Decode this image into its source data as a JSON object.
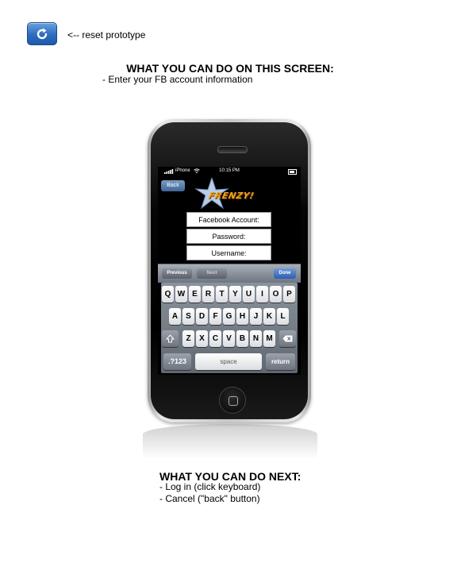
{
  "reset": {
    "icon": "refresh-icon",
    "label": "<-- reset prototype"
  },
  "screen_section": {
    "heading": "WHAT YOU CAN DO ON THIS SCREEN:",
    "items": [
      "- Enter your FB account information"
    ]
  },
  "phone": {
    "status_bar": {
      "carrier": "iPhone",
      "time": "10:15 PM",
      "signal_icon": "signal-bars-icon",
      "wifi_icon": "wifi-icon",
      "battery_icon": "battery-icon"
    },
    "back_label": "Back",
    "logo_text": "FRENZY!",
    "fields": [
      "Facebook Account:",
      "Password:",
      "Username:"
    ],
    "accessory": {
      "previous": "Previous",
      "next": "Next",
      "done": "Done"
    },
    "keyboard": {
      "row1": [
        "Q",
        "W",
        "E",
        "R",
        "T",
        "Y",
        "U",
        "I",
        "O",
        "P"
      ],
      "row2": [
        "A",
        "S",
        "D",
        "F",
        "G",
        "H",
        "J",
        "K",
        "L"
      ],
      "row3": [
        "Z",
        "X",
        "C",
        "V",
        "B",
        "N",
        "M"
      ],
      "numbers": ".?123",
      "space": "space",
      "return": "return"
    }
  },
  "next_section": {
    "heading": "WHAT YOU CAN DO NEXT:",
    "items": [
      "- Log in (click keyboard)",
      "- Cancel (\"back\" button)"
    ]
  }
}
